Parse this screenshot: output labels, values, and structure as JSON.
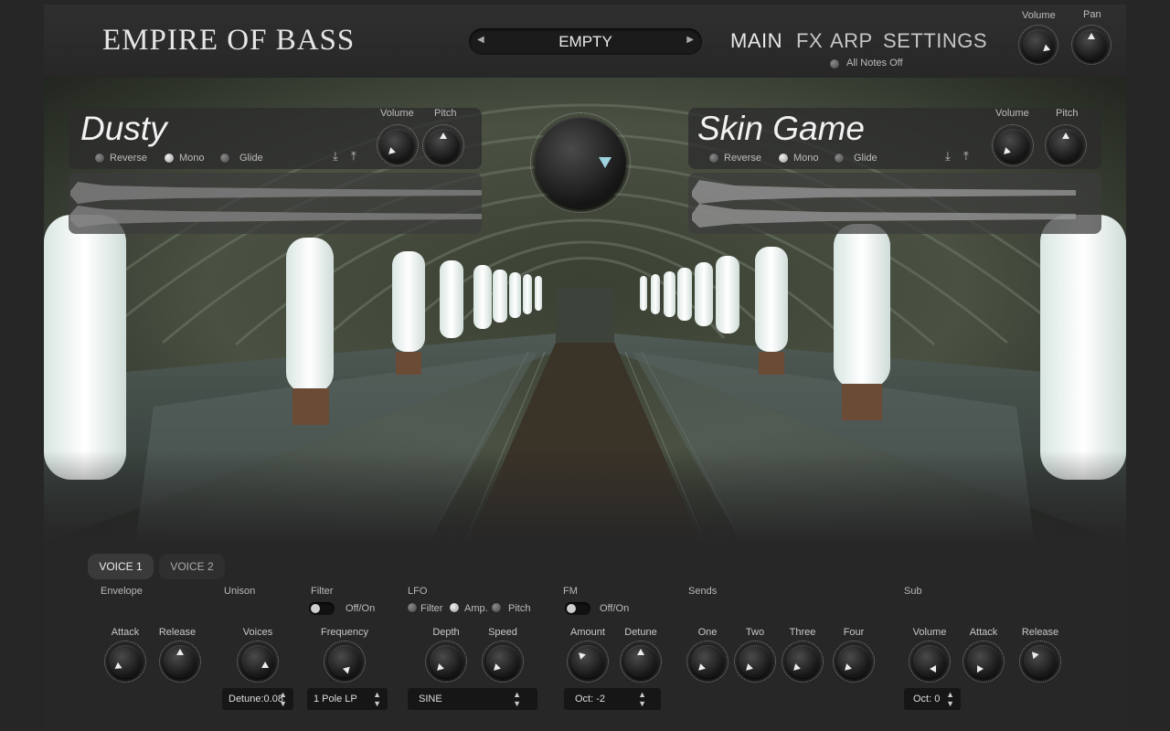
{
  "brand": "EMPIRE OF BASS",
  "preset": {
    "name": "EMPTY",
    "prev_icon": "triangle-left",
    "next_icon": "triangle-right"
  },
  "nav": {
    "main": "MAIN",
    "fx": "FX",
    "arp": "ARP",
    "settings": "SETTINGS"
  },
  "master": {
    "volume_label": "Volume",
    "pan_label": "Pan",
    "all_notes_off": "All Notes Off"
  },
  "slots": [
    {
      "name": "Dusty",
      "volume_label": "Volume",
      "pitch_label": "Pitch",
      "reverse": "Reverse",
      "mono": "Mono",
      "glide": "Glide",
      "mono_on": true
    },
    {
      "name": "Skin Game",
      "volume_label": "Volume",
      "pitch_label": "Pitch",
      "reverse": "Reverse",
      "mono": "Mono",
      "glide": "Glide",
      "mono_on": true
    }
  ],
  "voice_tabs": [
    "VOICE 1",
    "VOICE 2"
  ],
  "sections": {
    "envelope": "Envelope",
    "unison": "Unison",
    "filter": "Filter",
    "lfo": "LFO",
    "fm": "FM",
    "sends": "Sends",
    "sub": "Sub"
  },
  "filter": {
    "toggle_label": "Off/On",
    "frequency_label": "Frequency",
    "type": "1 Pole LP"
  },
  "envelope": {
    "attack": "Attack",
    "release": "Release"
  },
  "unison": {
    "voices": "Voices",
    "detune": "Detune:0.08"
  },
  "lfo": {
    "filter": "Filter",
    "amp": "Amp.",
    "pitch": "Pitch",
    "depth": "Depth",
    "speed": "Speed",
    "shape": "SINE"
  },
  "fm": {
    "toggle_label": "Off/On",
    "amount": "Amount",
    "detune": "Detune",
    "octave": "Oct: -2"
  },
  "sends": {
    "one": "One",
    "two": "Two",
    "three": "Three",
    "four": "Four"
  },
  "sub": {
    "volume": "Volume",
    "attack": "Attack",
    "release": "Release",
    "octave": "Oct: 0"
  },
  "colors": {
    "background": "#262626",
    "panel": "#2d2d2d",
    "text": "#e8e8e8"
  },
  "icons": {
    "download": "download-icon",
    "upload": "upload-icon"
  }
}
